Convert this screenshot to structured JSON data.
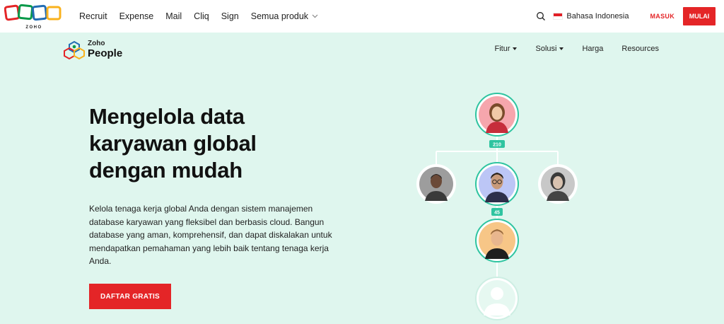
{
  "topbar": {
    "logo_text": "ZOHO",
    "nav": [
      "Recruit",
      "Expense",
      "Mail",
      "Cliq",
      "Sign"
    ],
    "more_label": "Semua produk",
    "search_icon": "search-icon",
    "language": "Bahasa Indonesia",
    "signin_label": "MASUK",
    "signup_label": "MULAI"
  },
  "product": {
    "brand": "Zoho",
    "name": "People",
    "nav": [
      {
        "label": "Fitur",
        "dropdown": true
      },
      {
        "label": "Solusi",
        "dropdown": true
      },
      {
        "label": "Harga",
        "dropdown": false
      },
      {
        "label": "Resources",
        "dropdown": false
      }
    ]
  },
  "hero": {
    "title": "Mengelola data karyawan global dengan mudah",
    "description": "Kelola tenaga kerja global Anda dengan sistem manajemen database karyawan yang fleksibel dan berbasis cloud. Bangun database yang aman, komprehensif, dan dapat diskalakan untuk mendapatkan pemahaman yang lebih baik tentang tenaga kerja Anda.",
    "cta_label": "DAFTAR GRATIS"
  },
  "org_chart": {
    "badge_top": "210",
    "badge_mid": "45"
  },
  "colors": {
    "accent": "#e42527",
    "hero_bg": "#dff6ee",
    "connector": "#2ec4a0"
  }
}
